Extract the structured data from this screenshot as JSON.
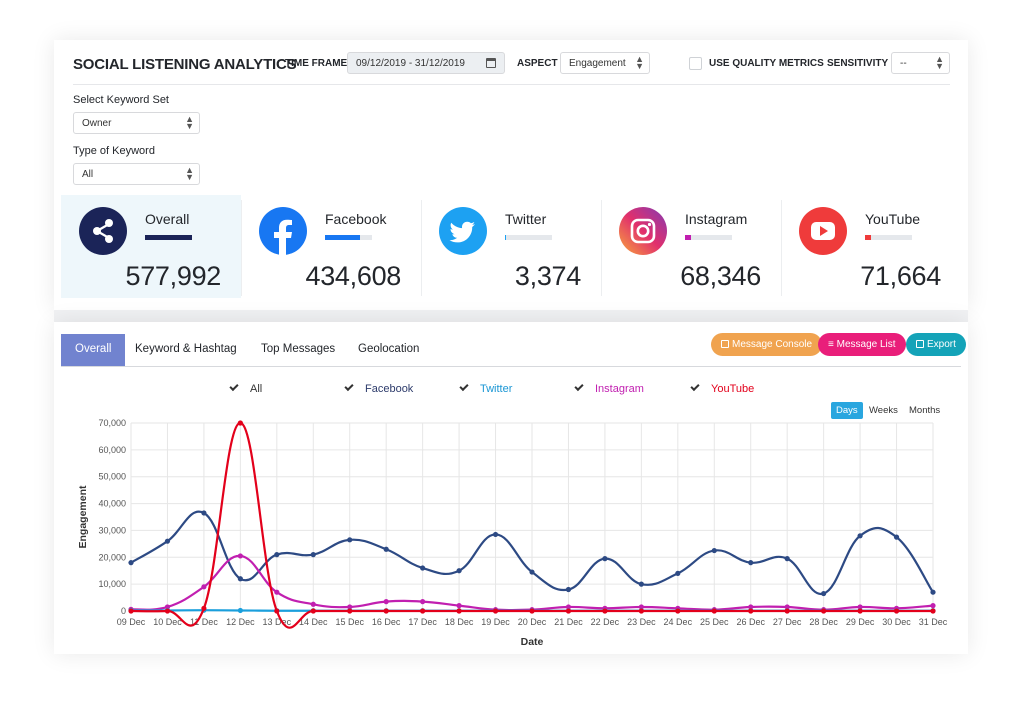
{
  "header": {
    "title": "SOCIAL LISTENING ANALYTICS",
    "time_frame_label": "TIME FRAME",
    "time_frame_value": "09/12/2019 - 31/12/2019",
    "aspect_label": "ASPECT",
    "aspect_value": "Engagement",
    "quality_label": "USE QUALITY METRICS",
    "sensitivity_label": "SENSITIVITY",
    "sensitivity_value": "--"
  },
  "filters": {
    "keyword_set_label": "Select Keyword Set",
    "keyword_set_value": "Owner",
    "keyword_type_label": "Type of Keyword",
    "keyword_type_value": "All"
  },
  "platforms": [
    {
      "name": "Overall",
      "value": "577,992",
      "icon": "share-icon",
      "color": "#1b2458",
      "share": 1.0
    },
    {
      "name": "Facebook",
      "value": "434,608",
      "icon": "facebook-icon",
      "color": "#1877f2",
      "share": 0.75
    },
    {
      "name": "Twitter",
      "value": "3,374",
      "icon": "twitter-icon",
      "color": "#1da1f2",
      "share": 0.01
    },
    {
      "name": "Instagram",
      "value": "68,346",
      "icon": "instagram-icon",
      "color": "#c13584",
      "share": 0.12
    },
    {
      "name": "YouTube",
      "value": "71,664",
      "icon": "youtube-icon",
      "color": "#ef3b3b",
      "share": 0.12
    }
  ],
  "tabs": [
    "Overall",
    "Keyword & Hashtag",
    "Top Messages",
    "Geolocation"
  ],
  "actions": {
    "console": "Message Console",
    "list": "Message List",
    "export": "Export"
  },
  "legend": [
    {
      "label": "All",
      "color": "#333333"
    },
    {
      "label": "Facebook",
      "color": "#2d3b6b"
    },
    {
      "label": "Twitter",
      "color": "#1a96d4"
    },
    {
      "label": "Instagram",
      "color": "#c11fb0"
    },
    {
      "label": "YouTube",
      "color": "#e3001b"
    }
  ],
  "periods": [
    "Days",
    "Weeks",
    "Months"
  ],
  "chart_data": {
    "type": "line",
    "xlabel": "Date",
    "ylabel": "Engagement",
    "ylim": [
      0,
      70000
    ],
    "yticks": [
      "0",
      "10,000",
      "20,000",
      "30,000",
      "40,000",
      "50,000",
      "60,000",
      "70,000"
    ],
    "categories": [
      "09 Dec",
      "10 Dec",
      "11 Dec",
      "12 Dec",
      "13 Dec",
      "14 Dec",
      "15 Dec",
      "16 Dec",
      "17 Dec",
      "18 Dec",
      "19 Dec",
      "20 Dec",
      "21 Dec",
      "22 Dec",
      "23 Dec",
      "24 Dec",
      "25 Dec",
      "26 Dec",
      "27 Dec",
      "28 Dec",
      "29 Dec",
      "30 Dec",
      "31 Dec"
    ],
    "grid": true,
    "series": [
      {
        "name": "Facebook",
        "color": "#2d4a84",
        "values": [
          18000,
          26000,
          36500,
          12000,
          21000,
          21000,
          26500,
          23000,
          16000,
          15000,
          28500,
          14500,
          8000,
          19500,
          10000,
          14000,
          22500,
          18000,
          19500,
          6500,
          28000,
          27500,
          7000
        ]
      },
      {
        "name": "Twitter",
        "color": "#1a9fdc",
        "values": [
          200,
          200,
          300,
          200,
          100,
          100,
          100,
          100,
          100,
          100,
          100,
          100,
          100,
          100,
          100,
          100,
          100,
          100,
          100,
          100,
          100,
          100,
          100
        ]
      },
      {
        "name": "Instagram",
        "color": "#c11fb0",
        "values": [
          600,
          1500,
          9000,
          20500,
          7000,
          2500,
          1500,
          3500,
          3500,
          2000,
          500,
          500,
          1500,
          1000,
          1500,
          1000,
          500,
          1500,
          1500,
          500,
          1500,
          1000,
          2000
        ]
      },
      {
        "name": "YouTube",
        "color": "#e3001b",
        "values": [
          0,
          0,
          1000,
          70000,
          0,
          0,
          0,
          0,
          0,
          0,
          0,
          0,
          0,
          0,
          0,
          0,
          0,
          0,
          0,
          0,
          0,
          0,
          0
        ]
      }
    ]
  }
}
